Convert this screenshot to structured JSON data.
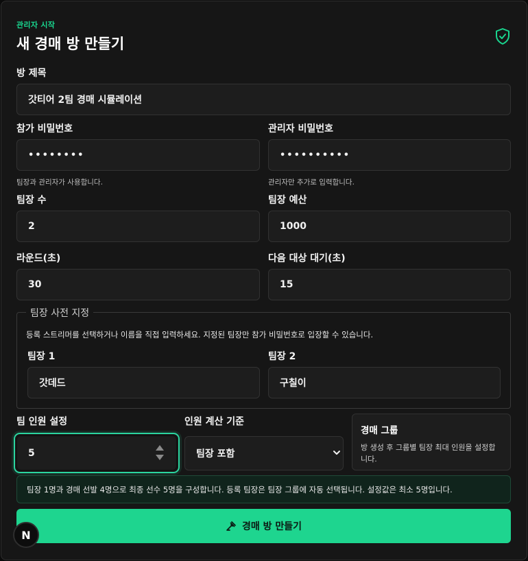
{
  "header": {
    "eyebrow": "관리자 시작",
    "title": "새 경매 방 만들기",
    "icon": "shield-check-icon"
  },
  "form": {
    "room_title": {
      "label": "방 제목",
      "value": "갓티어 2팀 경매 시뮬레이션"
    },
    "participant_password": {
      "label": "참가 비밀번호",
      "value": "••••••••",
      "hint": "팀장과 관리자가 사용합니다."
    },
    "admin_password": {
      "label": "관리자 비밀번호",
      "value": "••••••••••",
      "hint": "관리자만 추가로 입력합니다."
    },
    "captain_count": {
      "label": "팀장 수",
      "value": "2"
    },
    "captain_budget": {
      "label": "팀장 예산",
      "value": "1000"
    },
    "round_seconds": {
      "label": "라운드(초)",
      "value": "30"
    },
    "next_wait_seconds": {
      "label": "다음 대상 대기(초)",
      "value": "15"
    }
  },
  "preset": {
    "legend": "팀장 사전 지정",
    "description": "등록 스트리머를 선택하거나 이름을 직접 입력하세요. 지정된 팀장만 참가 비밀번호로 입장할 수 있습니다.",
    "captains": [
      {
        "label": "팀장 1",
        "value": "갓데드"
      },
      {
        "label": "팀장 2",
        "value": "구칠이"
      }
    ]
  },
  "team": {
    "size_label": "팀 인원 설정",
    "size_value": "5",
    "count_basis_label": "인원 계산 기준",
    "count_basis_value": "팀장 포함",
    "group_title": "경매 그룹",
    "group_desc": "방 생성 후 그룹별 팀장 최대 인원을 설정합니다."
  },
  "info": "팀장 1명과 경매 선발 4명으로 최종 선수 5명을 구성합니다. 등록 팀장은 팀장 그룹에 자동 선택됩니다. 설정값은 최소 5명입니다.",
  "submit_label": "경매 방 만들기",
  "badge": "N",
  "colors": {
    "accent": "#1ed58f",
    "background": "#161616",
    "field": "#1d1d1d"
  }
}
